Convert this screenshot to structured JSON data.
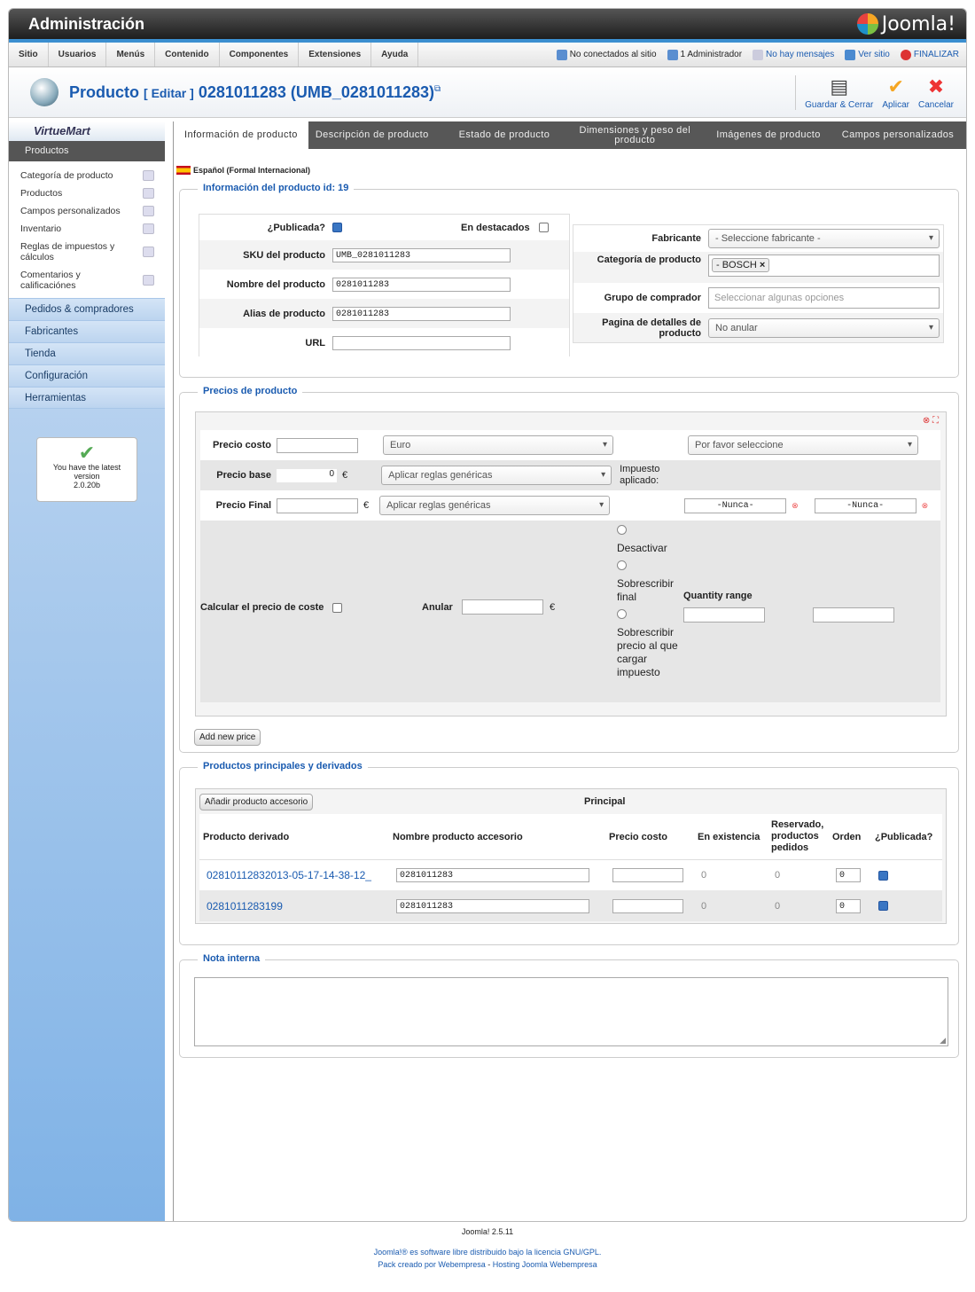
{
  "header": {
    "title": "Administración",
    "logo": "Joomla!"
  },
  "menu": {
    "items": [
      "Sitio",
      "Usuarios",
      "Menús",
      "Contenido",
      "Componentes",
      "Extensiones",
      "Ayuda"
    ],
    "status": {
      "not_connected": "No conectados al sitio",
      "admins": "1 Administrador",
      "messages": "No hay mensajes",
      "view_site": "Ver sitio",
      "logout": "FINALIZAR"
    }
  },
  "toolbar": {
    "title": "Producto",
    "edit": "[ Editar ]",
    "product_ref": "0281011283 (UMB_0281011283)",
    "save_close": "Guardar & Cerrar",
    "apply": "Aplicar",
    "cancel": "Cancelar"
  },
  "sidebar": {
    "brand": "VirtueMart",
    "section": "Productos",
    "items": [
      {
        "label": "Categoría de producto"
      },
      {
        "label": "Productos"
      },
      {
        "label": "Campos personalizados"
      },
      {
        "label": "Inventario"
      },
      {
        "label": "Reglas de impuestos y cálculos"
      },
      {
        "label": "Comentarios y calificaciónes"
      }
    ],
    "nav": [
      "Pedidos & compradores",
      "Fabricantes",
      "Tienda",
      "Configuración",
      "Herramientas"
    ],
    "version": {
      "line1": "You have the latest",
      "line2": "version",
      "line3": "2.0.20b"
    }
  },
  "tabs": [
    "Información de producto",
    "Descripción de producto",
    "Estado de producto",
    "Dimensiones y peso del producto",
    "Imágenes de producto",
    "Campos personalizados"
  ],
  "language": "Español (Formal Internacional)",
  "info": {
    "legend": "Información del producto id: 19",
    "published_label": "¿Publicada?",
    "featured_label": "En destacados",
    "sku_label": "SKU del producto",
    "sku": "UMB_0281011283",
    "name_label": "Nombre del producto",
    "name": "0281011283",
    "alias_label": "Alias de producto",
    "alias": "0281011283",
    "url_label": "URL",
    "manufacturer_label": "Fabricante",
    "manufacturer": "- Seleccione fabricante -",
    "category_label": "Categoría de producto",
    "category": "- BOSCH",
    "group_label": "Grupo de comprador",
    "group_placeholder": "Seleccionar algunas opciones",
    "detail_label": "Pagina de detalles de producto",
    "detail": "No anular"
  },
  "prices": {
    "legend": "Precios de producto",
    "cost_label": "Precio costo",
    "currency": "Euro",
    "select": "Por favor seleccione",
    "base_label": "Precio base",
    "base": "0",
    "euro": "€",
    "rules1": "Aplicar reglas genéricas",
    "tax_label": "Impuesto aplicado:",
    "final_label": "Precio Final",
    "rules2": "Aplicar reglas genéricas",
    "never1": "-Nunca-",
    "never2": "-Nunca-",
    "calc_label": "Calcular el precio de coste",
    "override_label": "Anular",
    "r1": "Desactivar",
    "r2": "Sobrescribir final",
    "r3": "Sobrescribir precio al que cargar impuesto",
    "qty_label": "Quantity range",
    "add_btn": "Add new price"
  },
  "related": {
    "legend": "Productos principales y derivados",
    "add_btn": "Añadir producto accesorio",
    "principal": "Principal",
    "headers": [
      "Producto derivado",
      "Nombre producto accesorio",
      "Precio costo",
      "En existencia",
      "Reservado, productos pedidos",
      "Orden",
      "¿Publicada?"
    ],
    "rows": [
      {
        "sku": "02810112832013-05-17-14-38-12_",
        "name": "0281011283",
        "stock": "0",
        "reserved": "0",
        "order": "0"
      },
      {
        "sku": "0281011283199",
        "name": "0281011283",
        "stock": "0",
        "reserved": "0",
        "order": "0"
      }
    ]
  },
  "note": {
    "legend": "Nota interna"
  },
  "footer": {
    "version": "Joomla! 2.5.11",
    "license": "Joomla!® es software libre distribuido bajo la licencia GNU/GPL.",
    "pack_prefix": "Pack creado por",
    "webempresa": "Webempresa",
    "sep": "-",
    "hosting": "Hosting Joomla Webempresa"
  }
}
